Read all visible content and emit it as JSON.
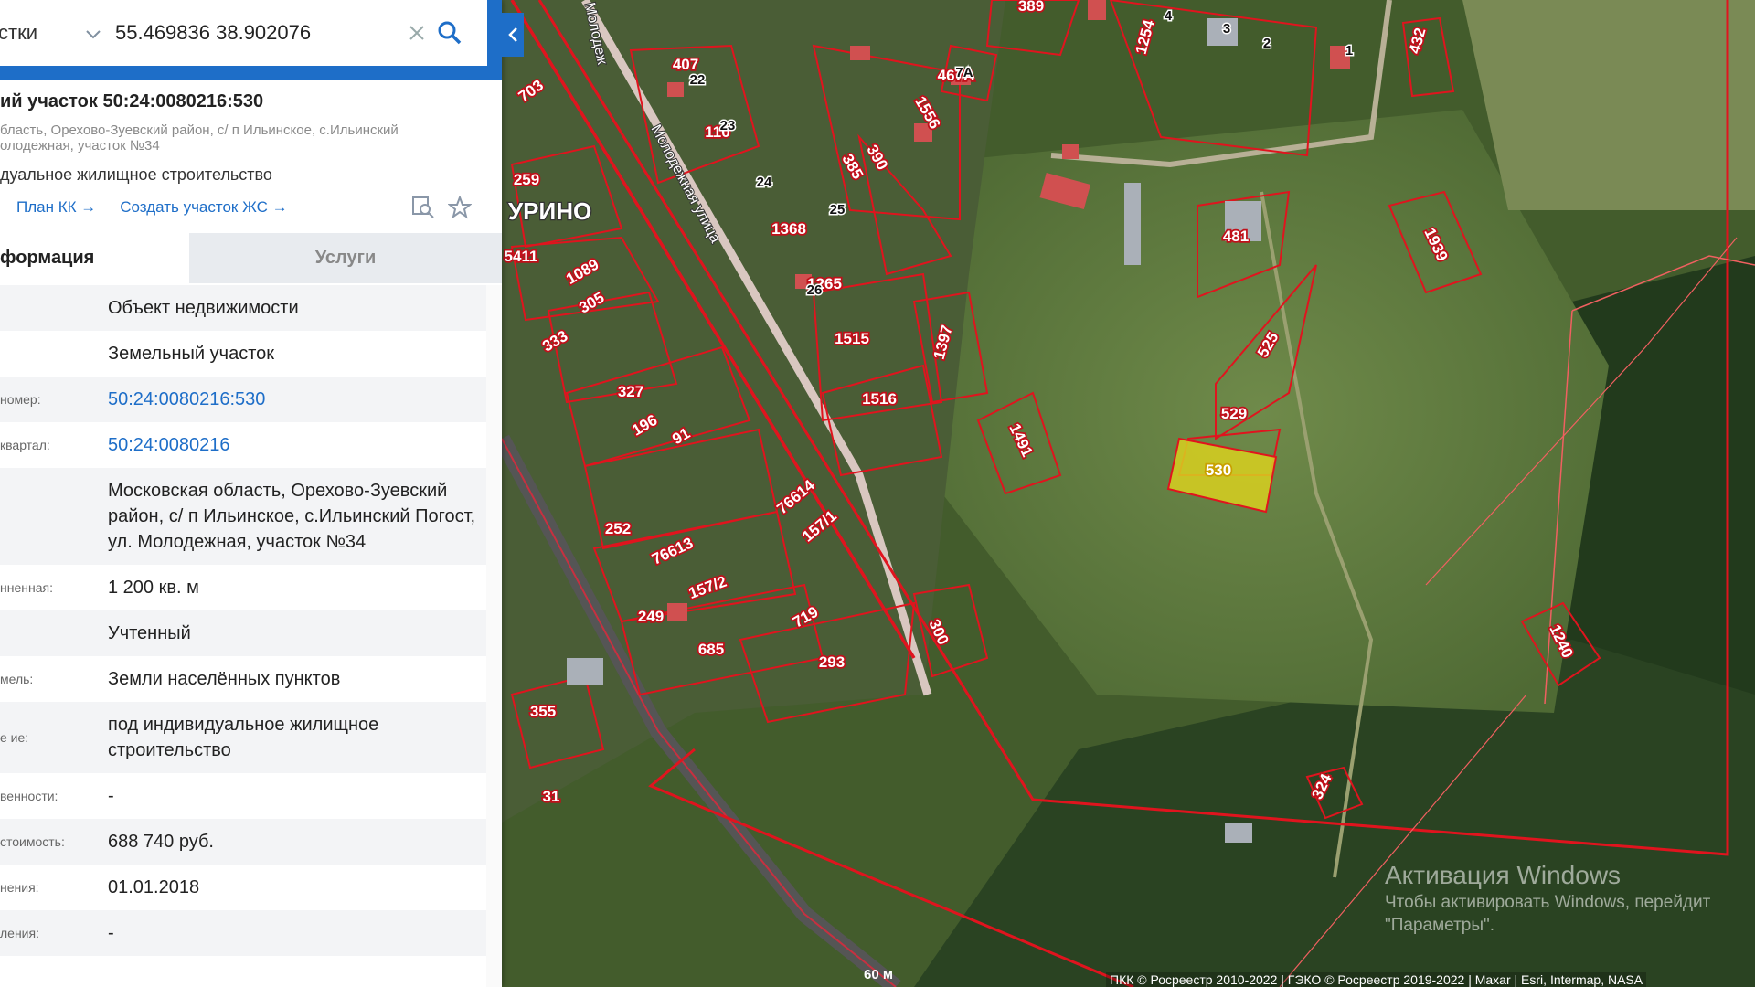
{
  "search": {
    "category": "стки",
    "query": "55.469836 38.902076"
  },
  "card": {
    "title": "ий участок 50:24:0080216:530",
    "address_sub": "бласть, Орехово-Зуевский район, с/ п Ильинское, с.Ильинский олодежная, участок №34",
    "purpose": "дуальное жилищное строительство",
    "actions": [
      "План КК →",
      "Создать участок ЖС →"
    ]
  },
  "tabs": {
    "info": "формация",
    "services": "Услуги"
  },
  "rows": [
    {
      "label": "",
      "value": "Объект недвижимости"
    },
    {
      "label": "",
      "value": "Земельный участок"
    },
    {
      "label": "номер:",
      "value": "50:24:0080216:530"
    },
    {
      "label": "квартал:",
      "value": "50:24:0080216"
    },
    {
      "label": "",
      "value": "Московская область, Орехово-Зуевский район, с/ п Ильинское, с.Ильинский Погост, ул. Молодежная, участок №34"
    },
    {
      "label": "нненная:",
      "value": "1 200 кв. м"
    },
    {
      "label": "",
      "value": "Учтенный"
    },
    {
      "label": "мель:",
      "value": "Земли населённых пунктов"
    },
    {
      "label": "е ие:",
      "value": "под индивидуальное жилищное строительство"
    },
    {
      "label": "венности:",
      "value": "-"
    },
    {
      "label": "стоимость:",
      "value": "688 740 руб."
    },
    {
      "label": "нения:",
      "value": "01.01.2018"
    },
    {
      "label": "ления:",
      "value": "-"
    }
  ],
  "map": {
    "village_label": "УРИНО",
    "street_label": "Молодежная улица",
    "street_label_2": "Молодеж",
    "parcels": [
      "389",
      "432",
      "1254",
      "407",
      "703",
      "1556",
      "390",
      "385",
      "110",
      "1368",
      "259",
      "1089",
      "305",
      "333",
      "327",
      "196",
      "91",
      "252",
      "76613",
      "76614",
      "157/1",
      "157/2",
      "249",
      "685",
      "719",
      "293",
      "300",
      "355",
      "31",
      "1515",
      "1516",
      "1397",
      "1491",
      "481",
      "525",
      "529",
      "530",
      "1939",
      "1240",
      "324",
      "5411",
      "1265",
      "467A"
    ],
    "houses": [
      "3",
      "4",
      "2",
      "1",
      "22",
      "23",
      "24",
      "25",
      "26",
      "7A"
    ],
    "highlight_color": "#d8d020",
    "boundary_color": "#e0141e"
  },
  "watermark": {
    "title": "Активация Windows",
    "line1": "Чтобы активировать Windows, перейдит",
    "line2": "\"Параметры\"."
  },
  "attribution": "ПКК © Росреестр 2010-2022 | ГЭКО © Росреестр 2019-2022 | Maxar | Esri, Intermap, NASA",
  "scale": "60 м"
}
